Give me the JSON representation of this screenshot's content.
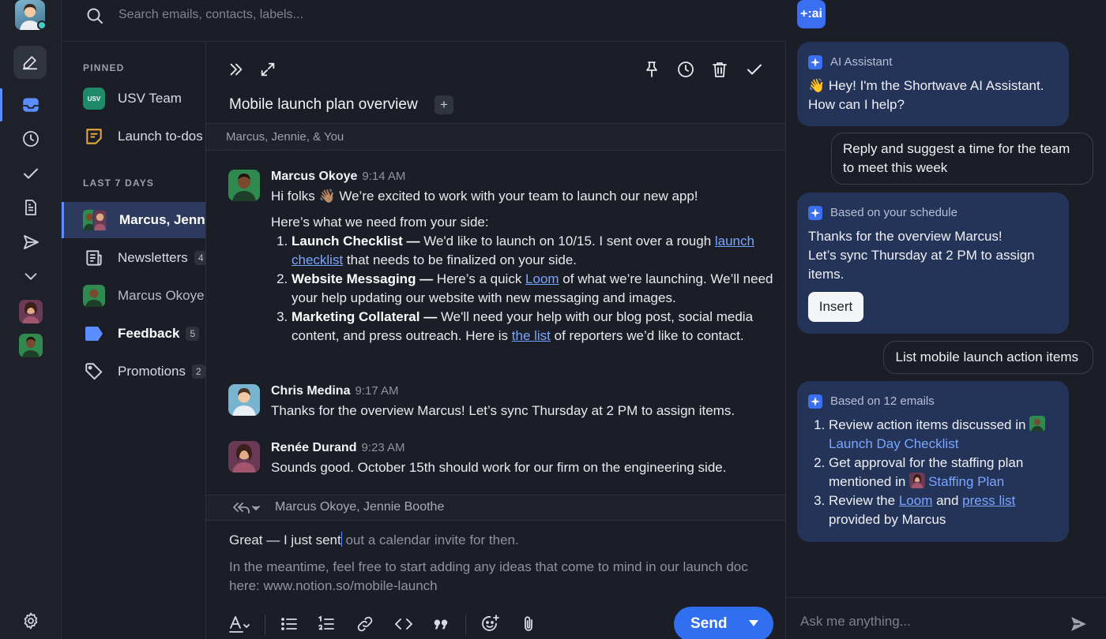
{
  "search": {
    "placeholder": "Search emails, contacts, labels..."
  },
  "folders": {
    "pinned_label": "PINNED",
    "pinned": [
      {
        "label": "USV Team",
        "badge": "USV"
      },
      {
        "label": "Launch to-dos"
      }
    ],
    "recent_label": "LAST 7 DAYS",
    "recent": [
      {
        "label": "Marcus, Jennie, & You"
      },
      {
        "label": "Newsletters",
        "count": "4"
      },
      {
        "label": "Marcus Okoye"
      },
      {
        "label": "Feedback",
        "count": "5"
      },
      {
        "label": "Promotions",
        "count": "2"
      }
    ]
  },
  "thread": {
    "title": "Mobile launch plan overview",
    "plus": "+",
    "participants": "Marcus, Jennie, & You",
    "messages": [
      {
        "author": "Marcus Okoye",
        "time": "9:14 AM",
        "greeting": "Hi folks 👋🏽 We’re excited to work with your team to launch our new app!",
        "intro": "Here’s what we need from your side:",
        "items": [
          {
            "title": "Launch Checklist —",
            "text_a": " We'd like to launch on 10/15. I sent over a rough ",
            "link": "launch checklist",
            "text_b": " that needs to be finalized on your side."
          },
          {
            "title": "Website Messaging —",
            "text_a": " Here’s a quick ",
            "link": "Loom",
            "text_b": " of what we’re launching. We’ll need your help updating our website with new messaging and images."
          },
          {
            "title": "Marketing Collateral —",
            "text_a": " We'll need your help with our blog post, social media content, and press outreach. Here is ",
            "link": "the list",
            "text_b": " of reporters we’d like to contact."
          }
        ]
      },
      {
        "author": "Chris Medina",
        "time": "9:17 AM",
        "body": "Thanks for the overview Marcus! Let’s sync Thursday at 2 PM to assign items."
      },
      {
        "author": "Renée Durand",
        "time": "9:23 AM",
        "body": "Sounds good. October 15th should work for our firm on the engineering side."
      }
    ],
    "reply_to": "Marcus Okoye, Jennie Boothe",
    "draft": {
      "typed": "Great — I just sent",
      "suggestion": " out a calendar invite for then.",
      "ghost": "In the meantime, feel free to start adding any ideas that come to mind in our launch doc here: www.notion.so/mobile-launch"
    },
    "send_label": "Send"
  },
  "ai": {
    "logo": "+:ai",
    "intro": {
      "header": "AI Assistant",
      "body": "👋 Hey! I'm the Shortwave AI Assistant. How can I help?"
    },
    "user_1": "Reply and suggest a time for the team to meet this week",
    "reply_1": {
      "header": "Based on your schedule",
      "lines": [
        "Thanks for the overview Marcus!",
        "Let’s sync Thursday at 2 PM to assign items."
      ],
      "insert_label": "Insert"
    },
    "user_2": "List mobile launch action items",
    "reply_2": {
      "header": "Based on 12 emails",
      "item1_text": "Review action items discussed in ",
      "item1_link": "Launch Day Checklist",
      "item2_text": "Get approval for the staffing plan mentioned in ",
      "item2_link": "Staffing Plan",
      "item3_a": "Review the ",
      "item3_link1": "Loom",
      "item3_b": " and ",
      "item3_link2": "press list",
      "item3_c": " provided by Marcus"
    },
    "ask_placeholder": "Ask me anything..."
  },
  "colors": {
    "accent": "#2f6ff0",
    "selected_row": "#2c3a5e",
    "ai_bubble": "#243358",
    "link": "#7aa6ff"
  }
}
